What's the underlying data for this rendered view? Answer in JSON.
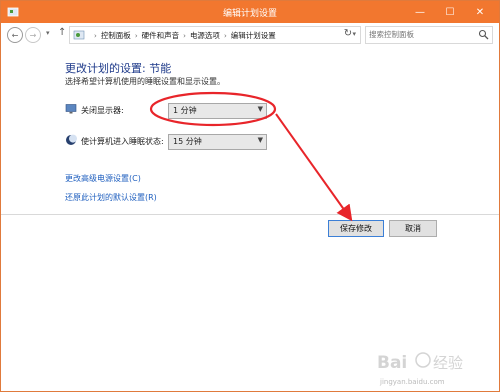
{
  "window": {
    "title": "编辑计划设置"
  },
  "titlebar": {
    "minimize": "—",
    "maximize": "☐",
    "close": "✕"
  },
  "nav": {
    "back": "←",
    "forward": "→",
    "dropdown": "▾",
    "up": "↑",
    "breadcrumbs": [
      "控制面板",
      "硬件和声音",
      "电源选项",
      "编辑计划设置"
    ],
    "separator": "›",
    "refresh": "↻",
    "search_placeholder": "搜索控制面板"
  },
  "content": {
    "title": "更改计划的设置: 节能",
    "subtitle": "选择希望计算机使用的睡眠设置和显示设置。",
    "display_off": {
      "label": "关闭显示器:",
      "value": "1 分钟"
    },
    "sleep": {
      "label": "使计算机进入睡眠状态:",
      "value": "15 分钟"
    },
    "link_advanced": "更改高级电源设置(C)",
    "link_restore": "还原此计划的默认设置(R)"
  },
  "footer": {
    "save": "保存修改",
    "cancel": "取消"
  },
  "colors": {
    "titlebar": "#f2772f",
    "annotation": "#e8252a",
    "link": "#1f5fbf",
    "heading": "#1e3a8a"
  },
  "watermark": {
    "brand": "Bai经验",
    "url": "jingyan.baidu.com"
  }
}
